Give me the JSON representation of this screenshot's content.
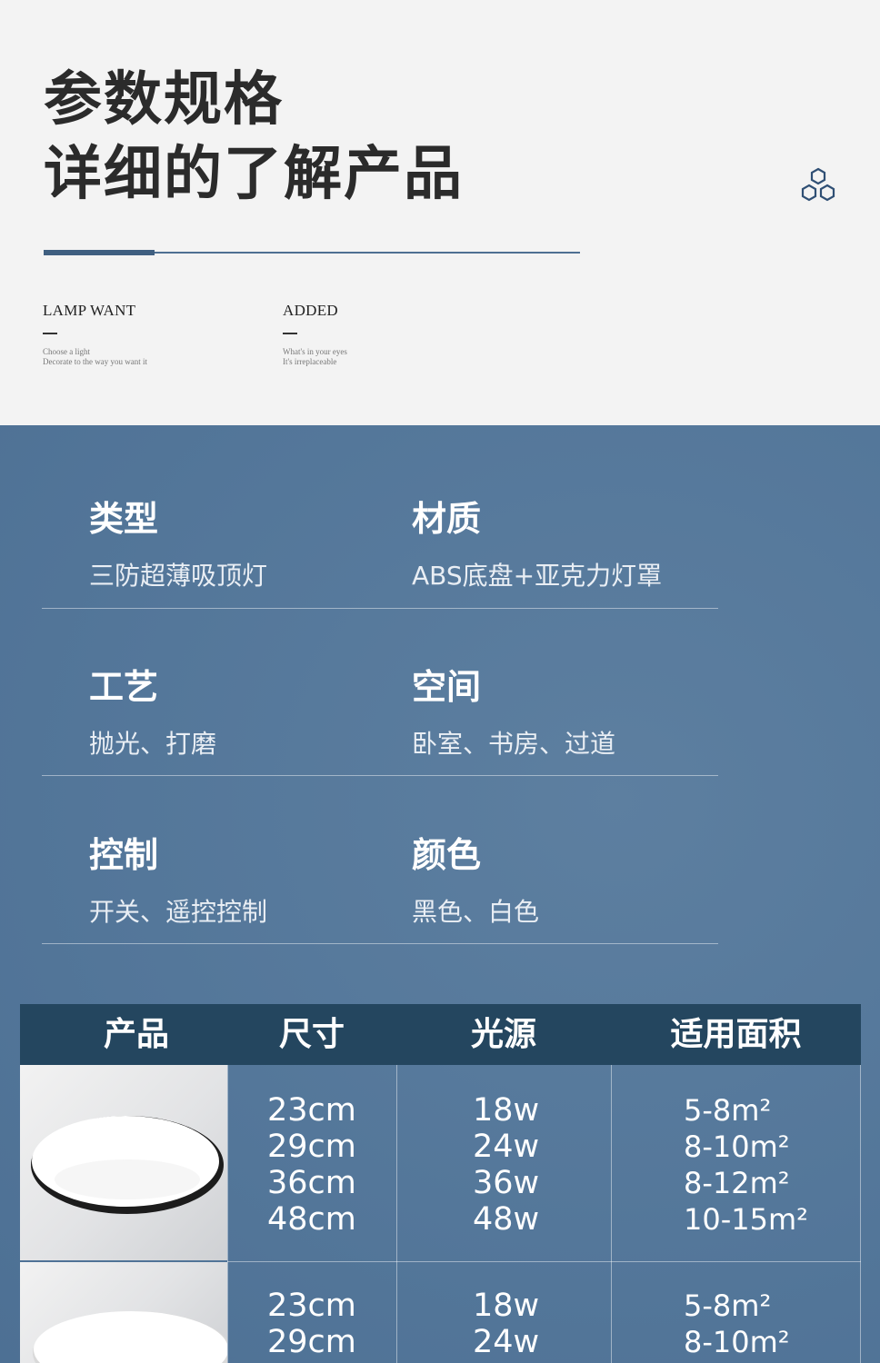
{
  "header": {
    "title_line1": "参数规格",
    "title_line2": "详细的了解产品",
    "icon": "hexagon-cluster-icon",
    "columns": [
      {
        "heading": "LAMP WANT",
        "line1": "Choose a light",
        "line2": "Decorate to the way you want it"
      },
      {
        "heading": "ADDED",
        "line1": "What's in your eyes",
        "line2": "It's irreplaceable"
      }
    ]
  },
  "specs": [
    {
      "key": "类型",
      "value": "三防超薄吸顶灯"
    },
    {
      "key": "材质",
      "value": "ABS底盘+亚克力灯罩"
    },
    {
      "key": "工艺",
      "value": "抛光、打磨"
    },
    {
      "key": "空间",
      "value": "卧室、书房、过道"
    },
    {
      "key": "控制",
      "value": "开关、遥控控制"
    },
    {
      "key": "颜色",
      "value": "黑色、白色"
    }
  ],
  "table": {
    "headers": [
      "产品",
      "尺寸",
      "光源",
      "适用面积"
    ],
    "rows": [
      {
        "sizes": [
          "23cm",
          "29cm",
          "36cm",
          "48cm"
        ],
        "watts": [
          "18w",
          "24w",
          "36w",
          "48w"
        ],
        "areas": [
          "5-8m²",
          "8-10m²",
          "8-12m²",
          "10-15m²"
        ]
      },
      {
        "sizes": [
          "23cm",
          "29cm"
        ],
        "watts": [
          "18w",
          "24w"
        ],
        "areas": [
          "5-8m²",
          "8-10m²"
        ]
      }
    ]
  },
  "colors": {
    "accent": "#3f5f80",
    "panel": "#54779a",
    "table_header": "#24465f"
  }
}
